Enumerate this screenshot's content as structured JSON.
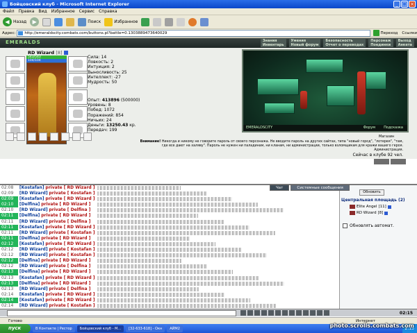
{
  "window": {
    "title": "Бойцовский клуб - Microsoft Internet Explorer",
    "menu": [
      "Файл",
      "Правка",
      "Вид",
      "Избранное",
      "Сервис",
      "Справка"
    ],
    "toolbar": {
      "back": "Назад",
      "search": "Поиск",
      "favorites": "Избранное"
    },
    "address_label": "Адрес:",
    "address": "http://emeraldscity.combats.com/buttons.pl?battle=0.1303889473640029",
    "go_label": "Переход",
    "links_label": "Ссылки"
  },
  "game": {
    "logo": "EMERALDS",
    "nav_links": [
      "Знания",
      "Умения",
      "Безопасность",
      "Персонаж",
      "Выход",
      "Инвентарь",
      "Новый форум",
      "Отчет о переводах",
      "Поединки",
      "Анкета"
    ],
    "character": {
      "name": "RD Wizard",
      "level": "[8]",
      "hp_text": "543/543",
      "mp_text": "104/104",
      "hp_fraction": 1.0,
      "mp_fraction": 1.0
    },
    "stats": [
      "Сила: 14",
      "Ловкость: 2",
      "Интуиция: 2",
      "Выносливость: 25",
      "Интеллект: -27",
      "Мудрость: 50"
    ],
    "stats2": {
      "exp_label": "Опыт:",
      "exp": "413896",
      "exp_next": "(500000)",
      "level": "Уровень: 8",
      "wins": "Побед: 1072",
      "losses": "Поражений: 854",
      "draws": "Ничьих: 24",
      "money_label": "Деньги:",
      "money": "13250.43",
      "money_unit": "кр.",
      "transfers": "Передач: 199"
    },
    "scene": {
      "caption": "EMERALDSCITY",
      "forum": "Форум",
      "hint": "Подсказка",
      "shop": "Магазин"
    },
    "warning_bold": "Внимание!",
    "warning_text": "Никогда и никому не говорите пароль от своего персонажа. Не вводите пароль на других сайтах, типа \"новый город\", \"лотерея\", \"там, где все дают на халяву\". Пароль не нужен ни паладинам, ни кланам, ни администрации, только взломщикам для кражи вашего героя.",
    "admin": "Администрация.",
    "online": "Сейчас в клубе 92 чел."
  },
  "chat": {
    "tabs": [
      "Чат",
      "Системные сообщения"
    ],
    "rows": [
      {
        "time": "02:08",
        "green": false,
        "user": "[Kostafan]",
        "target": "private [ RD Wizard ]"
      },
      {
        "time": "02:09",
        "green": false,
        "user": "[RD Wizard]",
        "target": "private [ Kostafan ]"
      },
      {
        "time": "02:09",
        "green": true,
        "user": "[Kostafan]",
        "target": "private [ RD Wizard ]"
      },
      {
        "time": "02:10",
        "green": true,
        "user": "[Delfina]",
        "target": "private [ RD Wizard ]"
      },
      {
        "time": "02:10",
        "green": false,
        "user": "[RD Wizard]",
        "target": "private [ Delfina ]"
      },
      {
        "time": "02:11",
        "green": true,
        "user": "[Delfina]",
        "target": "private [ RD Wizard ]"
      },
      {
        "time": "02:11",
        "green": false,
        "user": "[RD Wizard]",
        "target": "private [ Delfina ]"
      },
      {
        "time": "02:11",
        "green": true,
        "user": "[Kostafan]",
        "target": "private [ RD Wizard ]"
      },
      {
        "time": "02:11",
        "green": false,
        "user": "[RD Wizard]",
        "target": "private [ Kostafan ]"
      },
      {
        "time": "02:11",
        "green": true,
        "user": "[Delfina]",
        "target": "private [ RD Wizard ]"
      },
      {
        "time": "02:12",
        "green": true,
        "user": "[Kostafan]",
        "target": "private [ RD Wizard ]"
      },
      {
        "time": "02:12",
        "green": false,
        "user": "[RD Wizard]",
        "target": "private [ Kostafan ]"
      },
      {
        "time": "02:12",
        "green": false,
        "user": "[RD Wizard]",
        "target": "private [ Kostafan ]"
      },
      {
        "time": "02:12",
        "green": true,
        "user": "[Delfina]",
        "target": "private [ RD Wizard ]"
      },
      {
        "time": "02:12",
        "green": false,
        "user": "[RD Wizard]",
        "target": "private [ Delfina ]"
      },
      {
        "time": "02:13",
        "green": true,
        "user": "[Delfina]",
        "target": "private [ RD Wizard ]"
      },
      {
        "time": "02:13",
        "green": false,
        "user": "[Kostafan]",
        "target": "private [ RD Wizard ]"
      },
      {
        "time": "02:13",
        "green": true,
        "user": "[Delfina]",
        "target": "private [ RD Wizard ]"
      },
      {
        "time": "02:13",
        "green": false,
        "user": "[RD Wizard]",
        "target": "private [ Delfina ]"
      },
      {
        "time": "02:14",
        "green": false,
        "user": "[Kostafan]",
        "target": "private [ RD Wizard ]"
      },
      {
        "time": "02:14",
        "green": true,
        "user": "[Kostafan]",
        "target": "private [ RD Wizard ]"
      },
      {
        "time": "02:14",
        "green": false,
        "user": "[RD Wizard]",
        "target": "private [ Kostafan ]"
      }
    ]
  },
  "sidebar": {
    "refresh": "Обновить",
    "room": "Центральная площадь (2)",
    "players": [
      {
        "name": "Elite Angel",
        "level": "[11]"
      },
      {
        "name": "RD Wizard",
        "level": "[8]"
      }
    ],
    "auto_refresh": "Обновлять автомат."
  },
  "clock": "02:15",
  "status": {
    "ready": "Готово",
    "zone": "Интернет"
  },
  "taskbar": {
    "start": "пуск",
    "tasks": [
      "В Контакте | Рестор",
      "Бойцовский клуб - М...",
      "[32-633-618] - Окн",
      "АЙМ2"
    ],
    "time": "2:15"
  },
  "watermark": "photo.scrolls.combats.com"
}
